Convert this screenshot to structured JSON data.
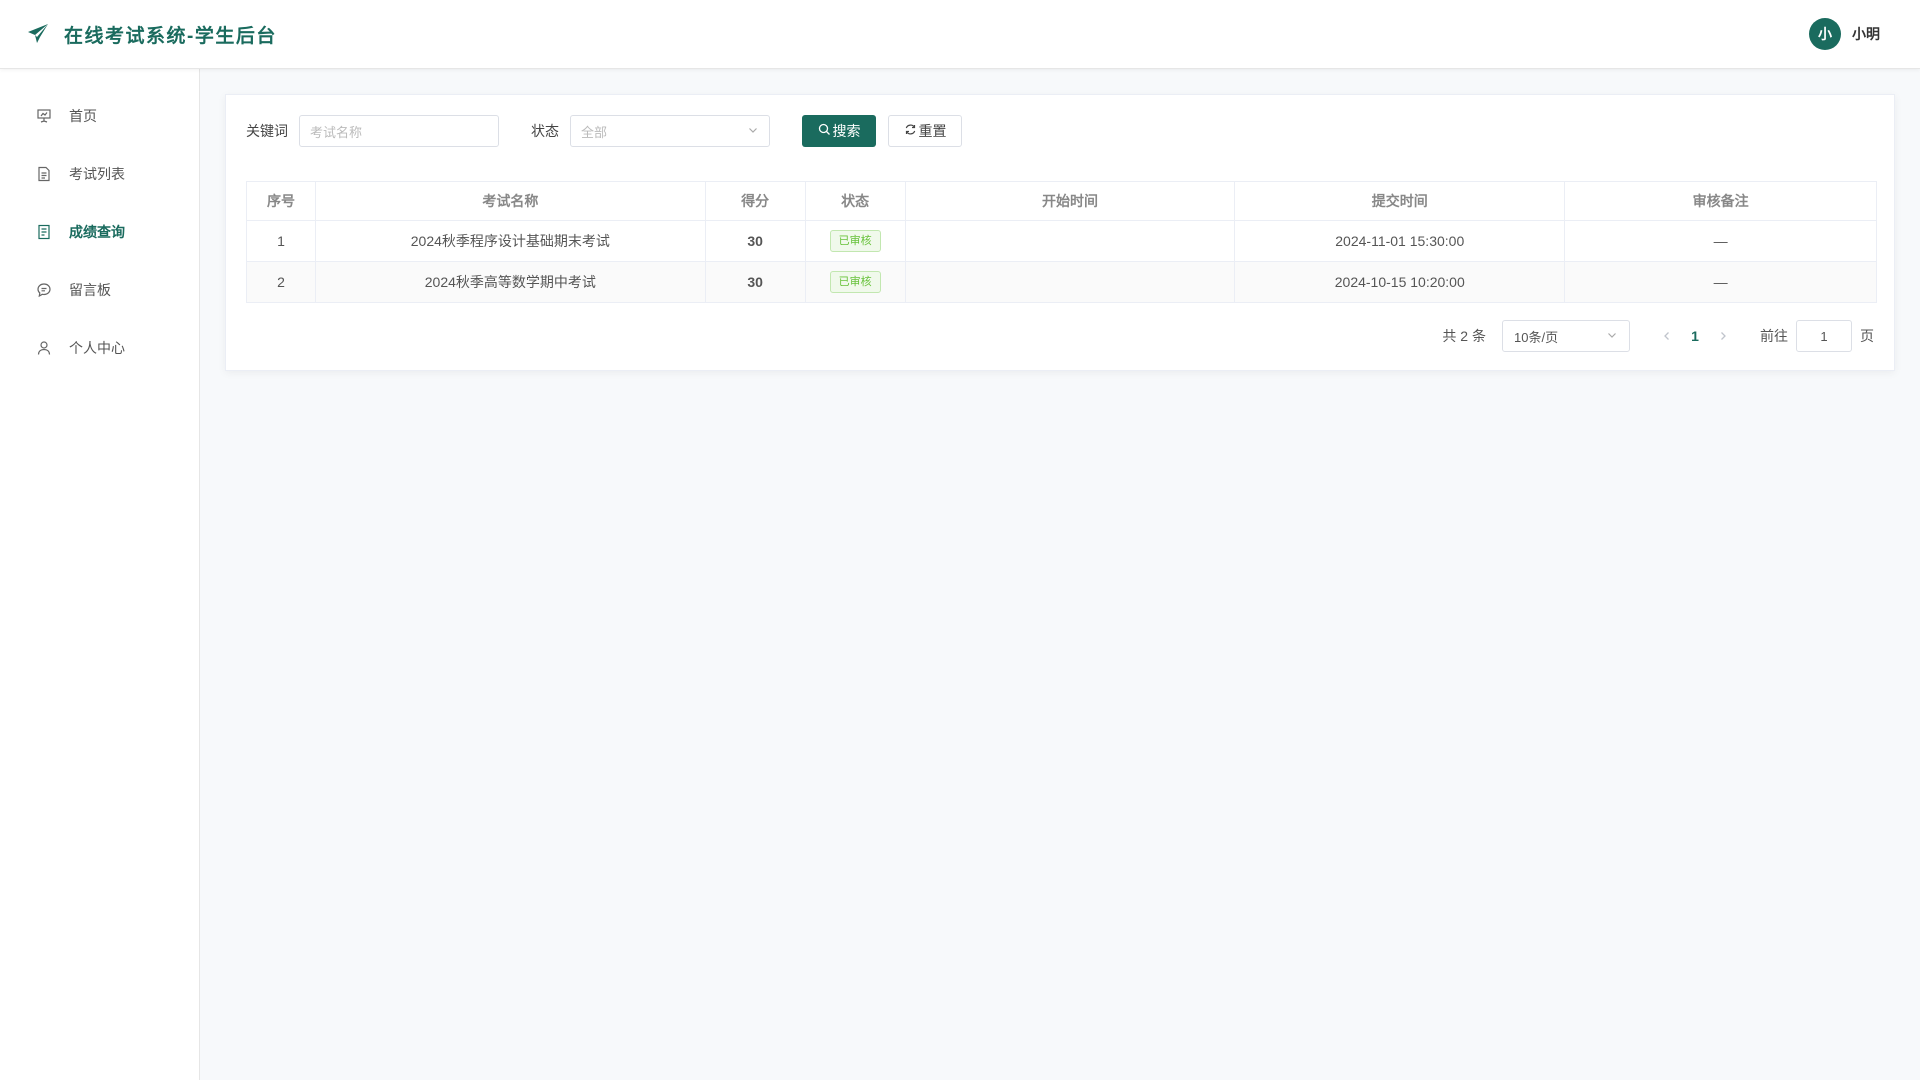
{
  "app": {
    "title": "在线考试系统-学生后台",
    "brand_icon": "paper-plane-icon",
    "accent_color": "#1a6b5e"
  },
  "user": {
    "avatar_text": "小",
    "name": "小明"
  },
  "sidebar": {
    "items": [
      {
        "label": "首页",
        "icon": "presentation-icon",
        "active": false
      },
      {
        "label": "考试列表",
        "icon": "document-icon",
        "active": false
      },
      {
        "label": "成绩查询",
        "icon": "list-document-icon",
        "active": true
      },
      {
        "label": "留言板",
        "icon": "chat-bubble-icon",
        "active": false
      },
      {
        "label": "个人中心",
        "icon": "user-icon",
        "active": false
      }
    ]
  },
  "filters": {
    "keyword_label": "关键词",
    "keyword_placeholder": "考试名称",
    "status_label": "状态",
    "status_value": "全部",
    "search_label": "搜索",
    "reset_label": "重置"
  },
  "table": {
    "headers": [
      "序号",
      "考试名称",
      "得分",
      "状态",
      "开始时间",
      "提交时间",
      "审核备注"
    ],
    "rows": [
      {
        "index": "1",
        "name": "2024秋季程序设计基础期末考试",
        "score": "30",
        "status": "已审核",
        "start": "",
        "submit": "2024-11-01 15:30:00",
        "remark": "—"
      },
      {
        "index": "2",
        "name": "2024秋季高等数学期中考试",
        "score": "30",
        "status": "已审核",
        "start": "",
        "submit": "2024-10-15 10:20:00",
        "remark": "—"
      }
    ]
  },
  "pagination": {
    "total_text": "共 2 条",
    "page_size": "10条/页",
    "current_page": "1",
    "goto_label": "前往",
    "goto_value": "1",
    "page_suffix": "页"
  }
}
